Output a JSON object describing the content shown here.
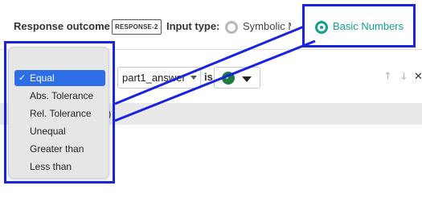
{
  "header": {
    "title": "Response outcome",
    "badge": "RESPONSE-2",
    "input_type_label": "Input type:",
    "options": [
      {
        "label": "Symbolic Math",
        "selected": false
      },
      {
        "label": "Basic Numbers",
        "selected": true
      }
    ]
  },
  "condition": {
    "variable": "part1_answer",
    "operator": "is",
    "value_icon": "checkmark-circle-icon",
    "value_color": "#1f7a3f"
  },
  "band_fragment": ")",
  "dropdown": {
    "items": [
      {
        "label": "Equal",
        "selected": true
      },
      {
        "label": "Abs. Tolerance",
        "selected": false
      },
      {
        "label": "Rel. Tolerance",
        "selected": false
      },
      {
        "label": "Unequal",
        "selected": false
      },
      {
        "label": "Greater than",
        "selected": false
      },
      {
        "label": "Less than",
        "selected": false
      }
    ]
  },
  "colors": {
    "accent": "#13a18b",
    "highlight": "#1a24e0",
    "selection": "#2d6ee6"
  },
  "icons": {
    "check": "✓",
    "up": "↑",
    "down": "↓",
    "close": "✕"
  }
}
